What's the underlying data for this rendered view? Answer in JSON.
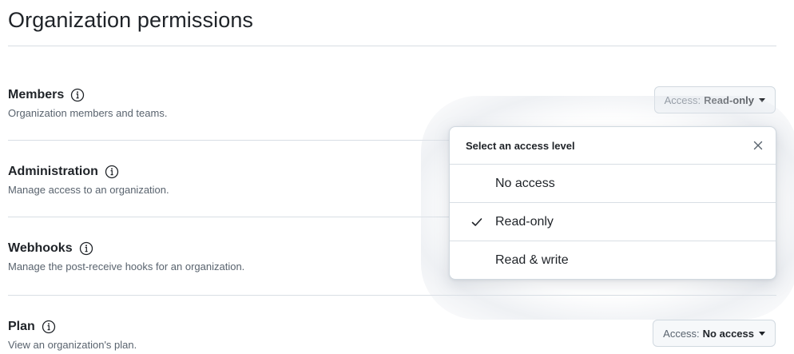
{
  "page": {
    "title": "Organization permissions"
  },
  "permissions": [
    {
      "name": "Members",
      "description": "Organization members and teams.",
      "access_prefix": "Access:",
      "access_value": "Read-only"
    },
    {
      "name": "Administration",
      "description": "Manage access to an organization."
    },
    {
      "name": "Webhooks",
      "description": "Manage the post-receive hooks for an organization."
    },
    {
      "name": "Plan",
      "description": "View an organization's plan.",
      "access_prefix": "Access:",
      "access_value": "No access"
    }
  ],
  "dropdown": {
    "header": "Select an access level",
    "options": [
      {
        "label": "No access",
        "selected": false
      },
      {
        "label": "Read-only",
        "selected": true
      },
      {
        "label": "Read & write",
        "selected": false
      }
    ]
  },
  "icons": {
    "info": "info-icon",
    "caret": "triangle-down-icon",
    "close": "close-icon",
    "check": "check-icon"
  },
  "colors": {
    "text": "#1f2328",
    "muted": "#59636e",
    "border": "#d1d9e0",
    "button_bg": "#f6f8fa"
  }
}
